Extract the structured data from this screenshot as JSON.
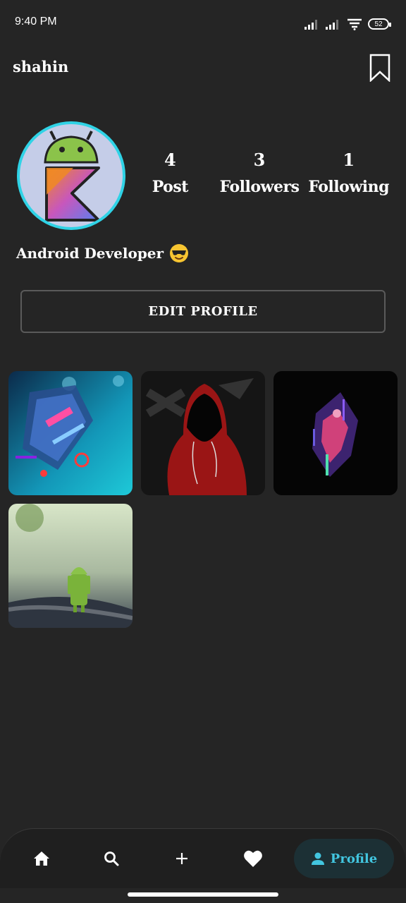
{
  "status_bar": {
    "time": "9:40 PM",
    "battery": "52",
    "icons": [
      "signal-icon",
      "signal-icon",
      "wifi-icon",
      "battery-icon"
    ]
  },
  "header": {
    "username": "shahin",
    "bookmark_icon": "bookmark-icon"
  },
  "profile": {
    "stats": [
      {
        "value": "4",
        "label": "Post"
      },
      {
        "value": "3",
        "label": "Followers"
      },
      {
        "value": "1",
        "label": "Following"
      }
    ],
    "bio": "Android Developer",
    "bio_emoji": "smiling-face-with-sunglasses",
    "edit_button": "EDIT PROFILE"
  },
  "posts": [
    "post-image-1",
    "post-image-2",
    "post-image-3",
    "post-image-4"
  ],
  "bottom_nav": {
    "items": [
      "home-icon",
      "search-icon",
      "add-icon",
      "heart-icon"
    ],
    "active_label": "Profile",
    "active_icon": "person-icon"
  },
  "colors": {
    "background": "#252525",
    "accent": "#42c6e0",
    "avatar_ring": "#2fd3e6"
  }
}
